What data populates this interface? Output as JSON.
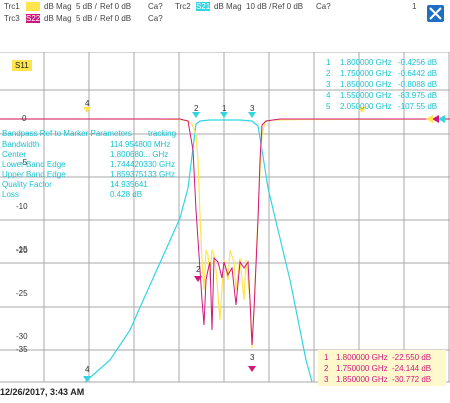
{
  "header": {
    "trc1": {
      "name": "Trc1",
      "format": "dB Mag",
      "scale": "5 dB /",
      "ref": "Ref 0 dB",
      "cal": "Ca?",
      "color": "#ffe44d"
    },
    "trc2": {
      "name": "Trc2",
      "param": "S21",
      "format": "dB Mag",
      "scale": "10 dB /",
      "ref": "Ref 0 dB",
      "cal": "Ca?",
      "color": "#33d6e0"
    },
    "trc3": {
      "name": "Trc3",
      "param": "S22",
      "format": "dB Mag",
      "scale": "5 dB /",
      "ref": "Ref 0 dB",
      "cal": "Ca?",
      "color": "#d0177d"
    },
    "channel": "1"
  },
  "trace_label": "S11",
  "y_ticks": [
    "0",
    "-5",
    "-10",
    "-15",
    "-20",
    "-25",
    "-30",
    "-35"
  ],
  "bandpass": {
    "title": "Bandpass Ref to Marker Parameters",
    "mode": "tracking",
    "rows": [
      {
        "label": "Bandwidth",
        "value": "114.954800 MHz"
      },
      {
        "label": "Center",
        "value": "1.800680... GHz"
      },
      {
        "label": "Lower Band Edge",
        "value": "1.744420330 GHz"
      },
      {
        "label": "Upper Band Edge",
        "value": "1.859375133 GHz"
      },
      {
        "label": "Quality Factor",
        "value": "14.935641"
      },
      {
        "label": "Loss",
        "value": "0.428 dB"
      }
    ]
  },
  "marker_table_top": [
    {
      "num": "1",
      "freq": "1.800000 GHz",
      "value": "-0.4256 dB"
    },
    {
      "num": "2",
      "freq": "1.750000 GHz",
      "value": "-0.6442 dB"
    },
    {
      "num": "3",
      "freq": "1.850000 GHz",
      "value": "-0.8088 dB"
    },
    {
      "num": "4",
      "freq": "1.550000 GHz",
      "value": "-83.975 dB"
    },
    {
      "num": "5",
      "freq": "2.050000 GHz",
      "value": "-107.55 dB"
    }
  ],
  "marker_table_bottom": [
    {
      "num": "1",
      "freq": "1.800000 GHz",
      "value": "-22.550 dB"
    },
    {
      "num": "2",
      "freq": "1.750000 GHz",
      "value": "-24.144 dB"
    },
    {
      "num": "3",
      "freq": "1.850000 GHz",
      "value": "-30.772 dB"
    }
  ],
  "footer": {
    "datetime": "12/26/2017, 3:43 AM"
  },
  "colors": {
    "yellow": "#ffe44d",
    "cyan": "#33d6e0",
    "magenta": "#d0177d",
    "grid": "#a0a0a0"
  },
  "icons": {
    "logo": "rohde-schwarz-logo"
  }
}
